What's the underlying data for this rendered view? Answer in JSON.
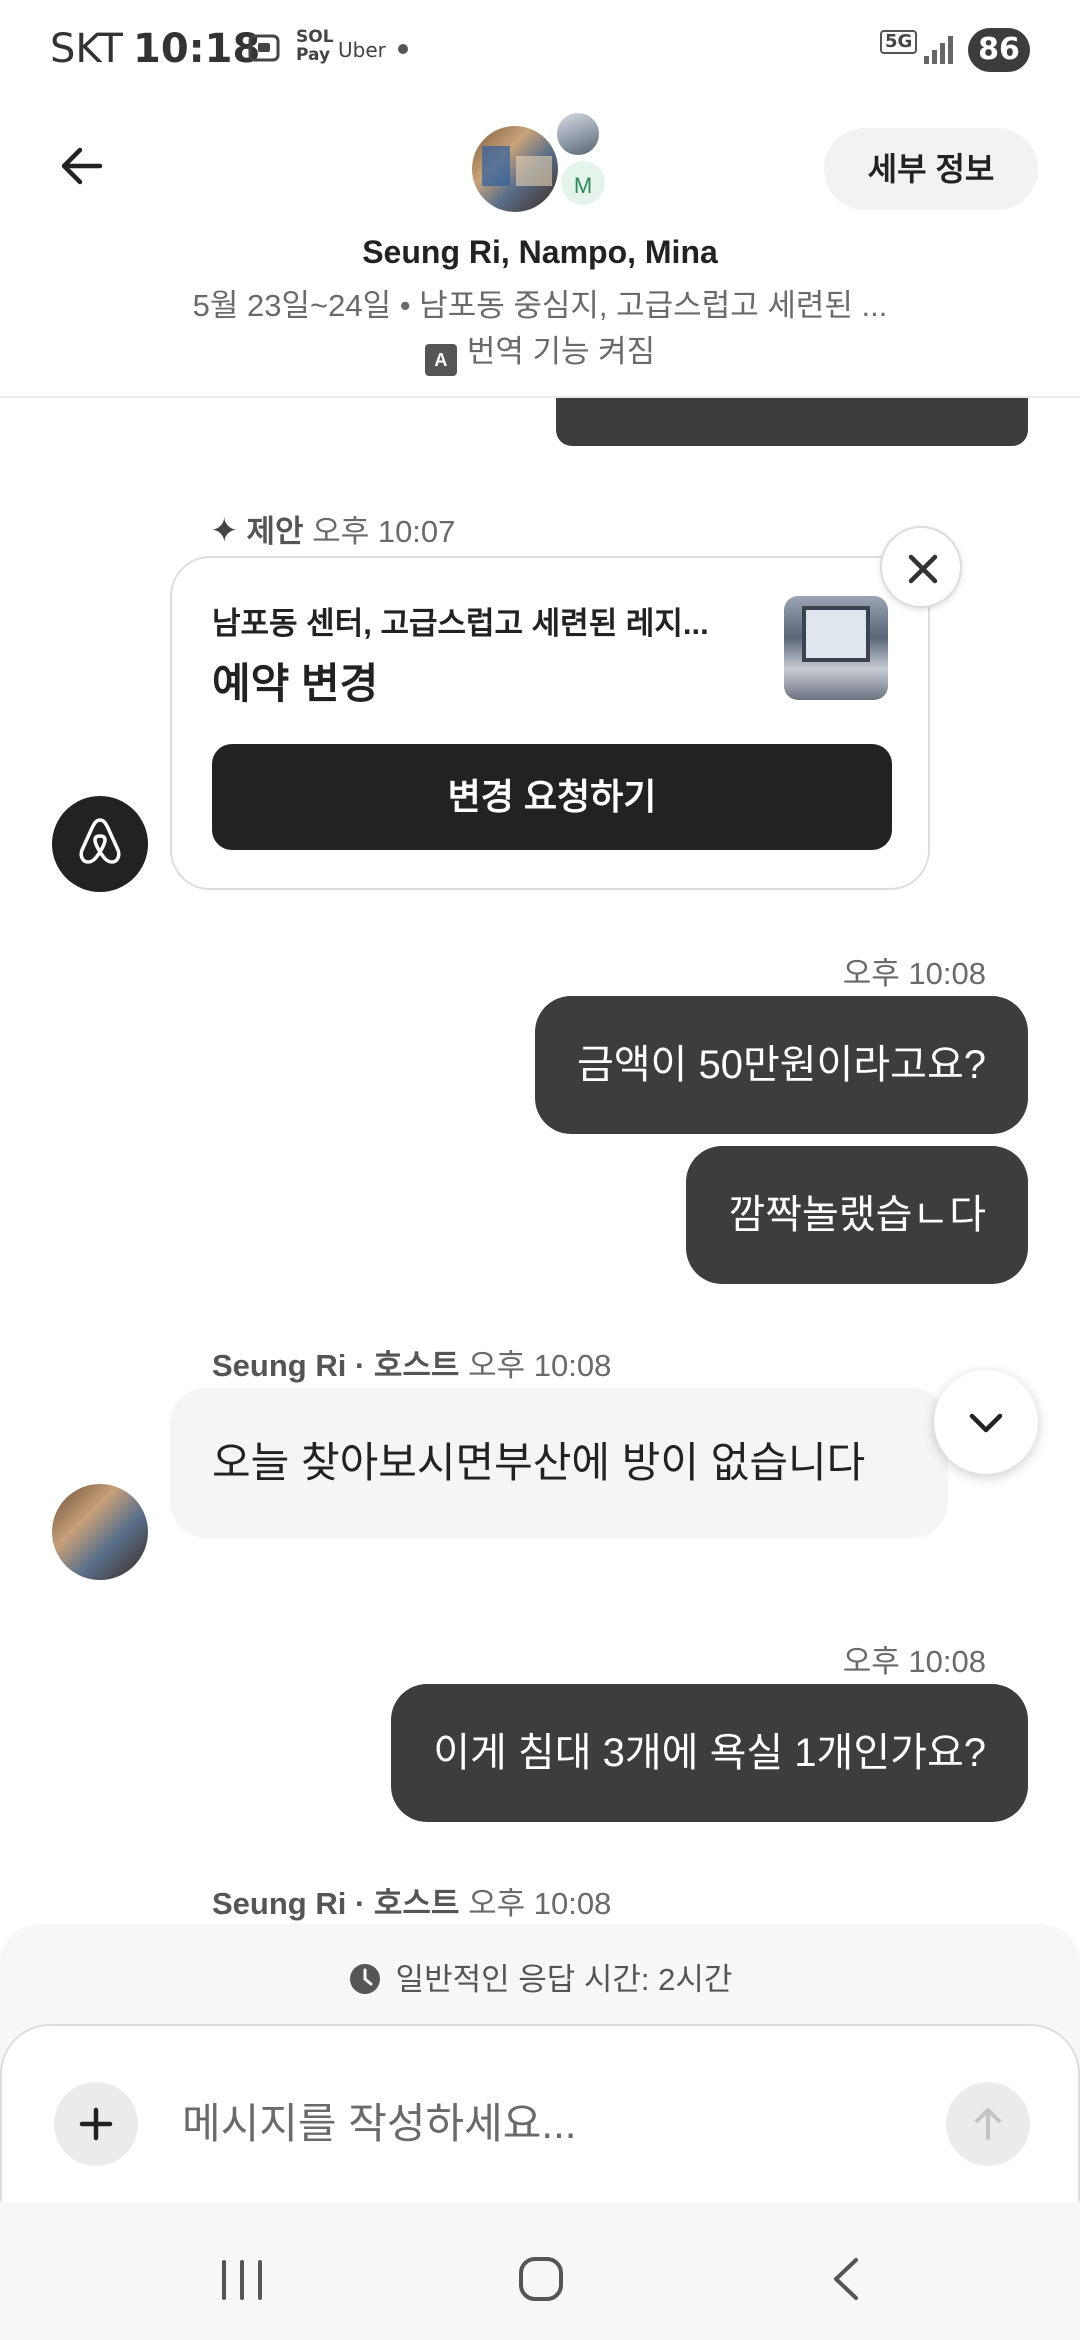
{
  "status_bar": {
    "carrier": "SKT",
    "time": "10:18",
    "sol_pay": "SOL Pay",
    "uber": "Uber",
    "network": "5G",
    "battery": "86"
  },
  "header": {
    "details_button": "세부 정보",
    "avatar_initial": "M",
    "participants": "Seung Ri, Nampo, Mina",
    "trip_summary": "5월 23일~24일 • 남포동 중심지, 고급스럽고 세련된 ...",
    "translation_icon_text": "A",
    "translation_status": "번역 기능 켜짐"
  },
  "suggestion": {
    "label": "제안",
    "time": "오후 10:07",
    "listing_name": "남포동 센터, 고급스럽고 세련된 레지...",
    "title": "예약 변경",
    "button": "변경 요청하기"
  },
  "messages": [
    {
      "time": "오후 10:08",
      "text": "금액이 50만원이라고요?"
    },
    {
      "text": "깜짝놀랬습ㄴ다"
    },
    {
      "sender": "Seung Ri · 호스트",
      "time": "오후 10:08",
      "text": "오늘 찾아보시면부산에 방이 없습니다"
    },
    {
      "time": "오후 10:08",
      "text": "이게 침대 3개에 욕실 1개인가요?"
    },
    {
      "sender": "Seung Ri · 호스트",
      "time": "오후 10:08"
    }
  ],
  "composer": {
    "response_time": "일반적인 응답 시간: 2시간",
    "placeholder": "메시지를 작성하세요..."
  },
  "icons": {
    "back": "arrow-left-icon",
    "close": "close-icon",
    "airbnb": "airbnb-logo-icon",
    "scroll_down": "chevron-down-icon",
    "clock": "clock-icon",
    "plus": "plus-icon",
    "send": "arrow-up-icon",
    "nav_recent": "recent-apps-icon",
    "nav_home": "home-icon",
    "nav_back": "nav-back-icon"
  }
}
